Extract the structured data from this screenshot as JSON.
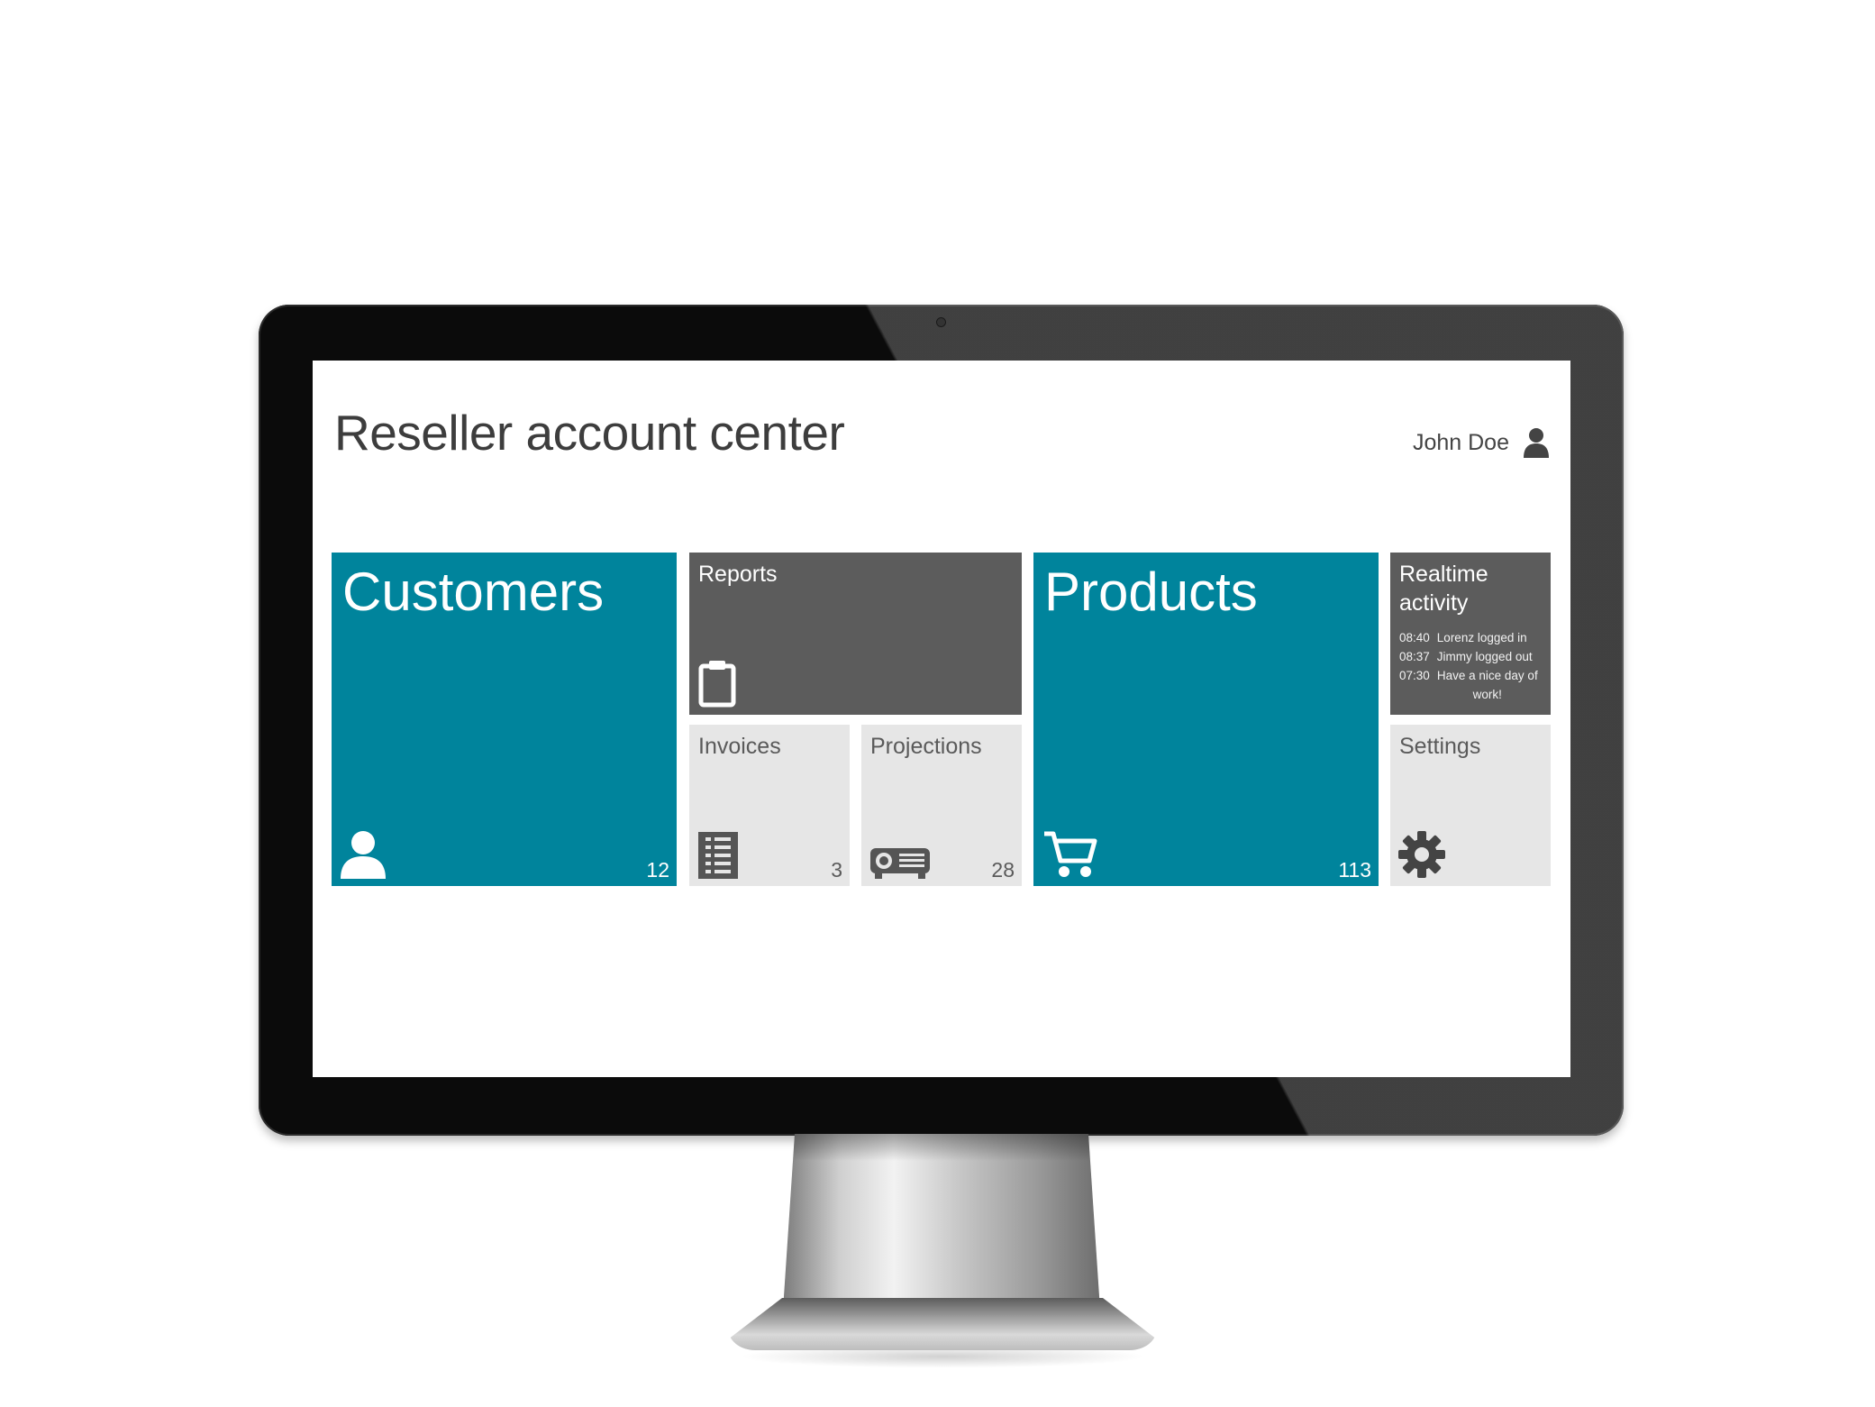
{
  "app": {
    "title": "Reseller account center"
  },
  "user": {
    "name": "John Doe",
    "icon": "user-icon"
  },
  "tiles": {
    "customers": {
      "label": "Customers",
      "count": "12",
      "icon": "person-icon",
      "color": "#00849c"
    },
    "reports": {
      "label": "Reports",
      "icon": "clipboard-icon",
      "color": "#5c5c5c"
    },
    "invoices": {
      "label": "Invoices",
      "count": "3",
      "icon": "document-list-icon",
      "color": "#e6e6e6"
    },
    "projections": {
      "label": "Projections",
      "count": "28",
      "icon": "projector-icon",
      "color": "#e6e6e6"
    },
    "products": {
      "label": "Products",
      "count": "113",
      "icon": "shopping-cart-icon",
      "color": "#00849c"
    },
    "realtime": {
      "label_line1": "Realtime",
      "label_line2": "activity",
      "color": "#5c5c5c",
      "events": [
        {
          "time": "08:40",
          "text": "Lorenz logged in"
        },
        {
          "time": "08:37",
          "text": "Jimmy logged out"
        },
        {
          "time": "07:30",
          "text": "Have a nice day of work!"
        }
      ]
    },
    "settings": {
      "label": "Settings",
      "icon": "gear-icon",
      "color": "#e6e6e6"
    }
  }
}
